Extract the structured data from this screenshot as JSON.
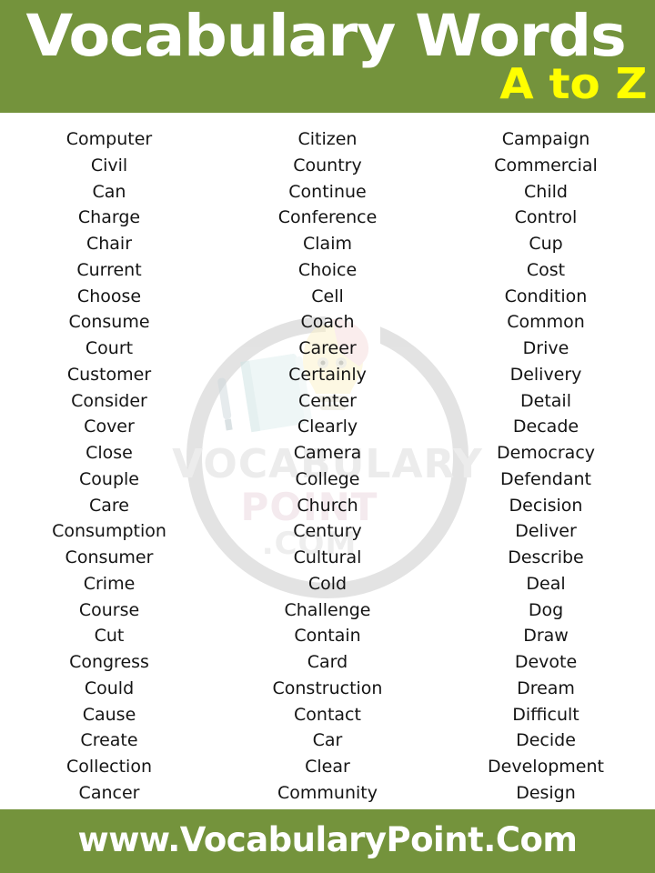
{
  "header": {
    "title": "Vocabulary Words",
    "subtitle": "A to Z",
    "background_color": "#74933C",
    "title_color": "#FFFFFF",
    "subtitle_color": "#FFFF00"
  },
  "watermark": {
    "line1": "VOCABULARY",
    "line2": "POINT",
    "line3": ".COM",
    "ring_color": "#DEDEDE"
  },
  "footer": {
    "url": "www.VocabularyPoint.Com",
    "background_color": "#74933C",
    "text_color": "#FFFFFF"
  },
  "columns": [
    {
      "words": [
        "Computer",
        "Civil",
        "Can",
        "Charge",
        "Chair",
        "Current",
        "Choose",
        "Consume",
        "Court",
        "Customer",
        "Consider",
        "Cover",
        "Close",
        "Couple",
        "Care",
        "Consumption",
        "Consumer",
        "Crime",
        "Course",
        "Cut",
        "Congress",
        "Could",
        "Cause",
        "Create",
        "Collection",
        "Cancer"
      ]
    },
    {
      "words": [
        "Citizen",
        "Country",
        "Continue",
        "Conference",
        "Claim",
        "Choice",
        "Cell",
        "Coach",
        "Career",
        "Certainly",
        "Center",
        "Clearly",
        "Camera",
        "College",
        "Church",
        "Century",
        "Cultural",
        "Cold",
        "Challenge",
        "Contain",
        "Card",
        "Construction",
        "Contact",
        "Car",
        "Clear",
        "Community"
      ]
    },
    {
      "words": [
        "Campaign",
        "Commercial",
        "Child",
        "Control",
        "Cup",
        "Cost",
        "Condition",
        "Common",
        "Drive",
        "Delivery",
        "Detail",
        "Decade",
        "Democracy",
        "Defendant",
        "Decision",
        "Deliver",
        "Describe",
        "Deal",
        "Dog",
        "Draw",
        "Devote",
        "Dream",
        "Difficult",
        "Decide",
        "Development",
        "Design"
      ]
    }
  ]
}
